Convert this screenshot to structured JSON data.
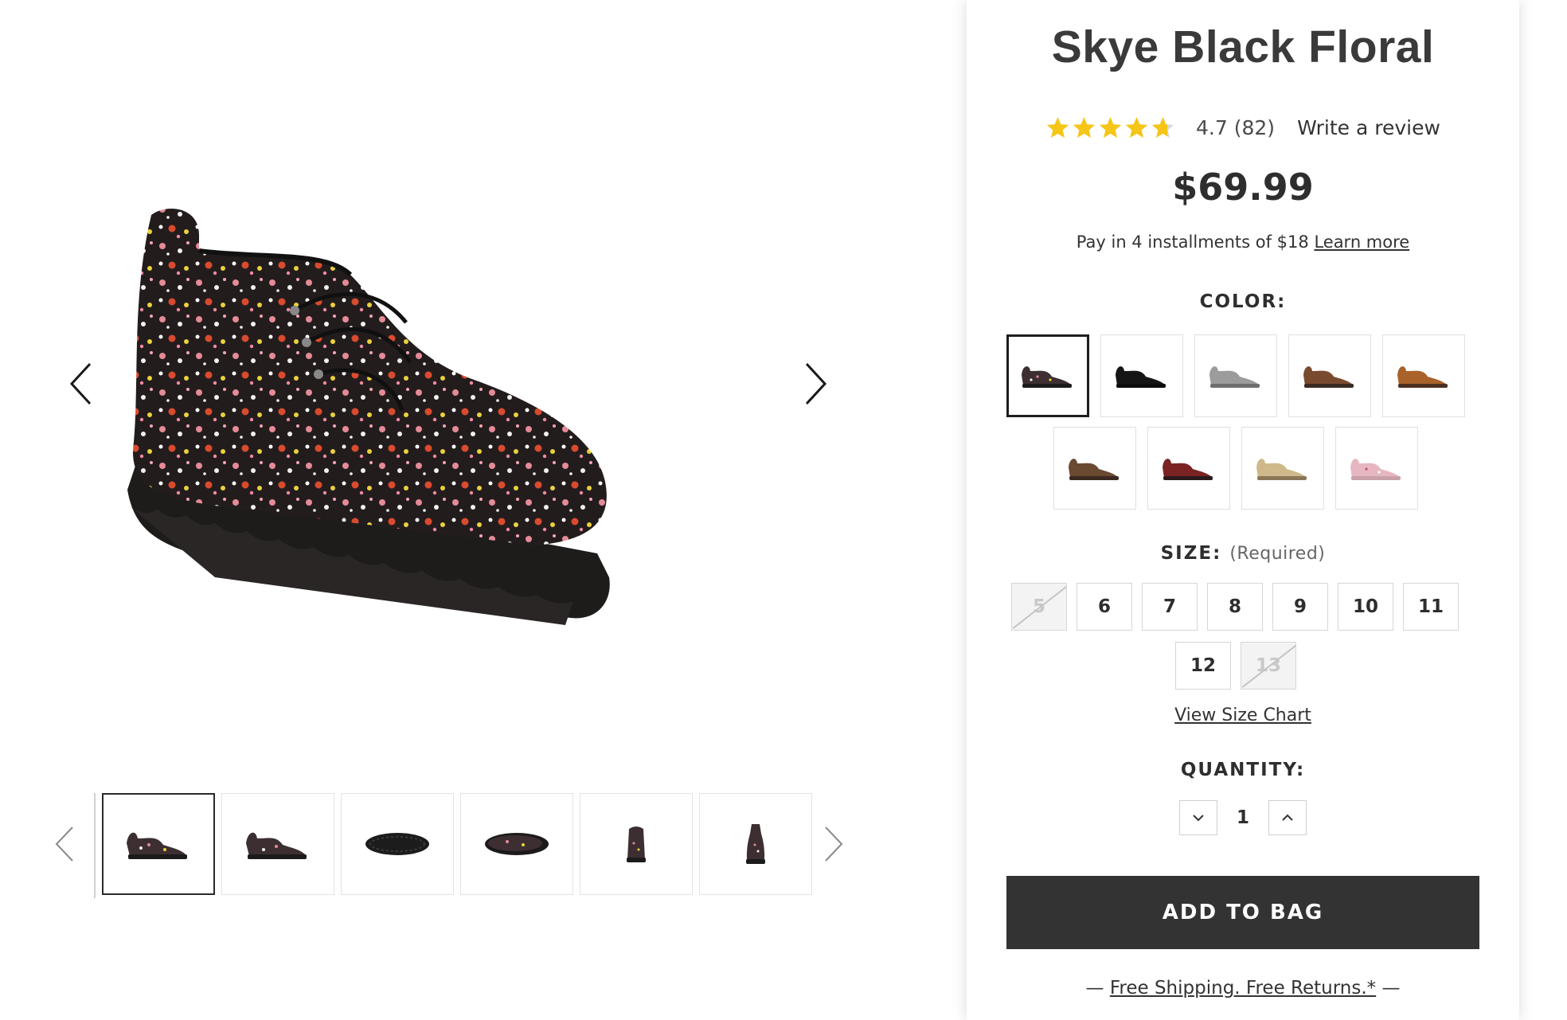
{
  "product": {
    "title": "Skye Black Floral",
    "rating_value": 4.7,
    "rating_text": "4.7 (82)",
    "write_review_label": "Write a review",
    "price": "$69.99",
    "installments_text": "Pay in 4 installments of $18",
    "learn_more_label": "Learn more"
  },
  "color": {
    "label": "COLOR:",
    "swatches": [
      {
        "name": "Black Floral",
        "color": "#3b3033",
        "selected": true
      },
      {
        "name": "Black",
        "color": "#151515"
      },
      {
        "name": "Gray",
        "color": "#9c9c9c"
      },
      {
        "name": "Chestnut",
        "color": "#7a4a2f"
      },
      {
        "name": "Hickory",
        "color": "#a9622a"
      },
      {
        "name": "Cocoa",
        "color": "#6b4a32"
      },
      {
        "name": "Red",
        "color": "#7b2323"
      },
      {
        "name": "Tan",
        "color": "#cfb98a"
      },
      {
        "name": "Pink Floral",
        "color": "#e6b7c1"
      }
    ]
  },
  "size": {
    "label": "SIZE:",
    "required_text": "(Required)",
    "options": [
      {
        "label": "5",
        "available": false
      },
      {
        "label": "6",
        "available": true
      },
      {
        "label": "7",
        "available": true
      },
      {
        "label": "8",
        "available": true
      },
      {
        "label": "9",
        "available": true
      },
      {
        "label": "10",
        "available": true
      },
      {
        "label": "11",
        "available": true
      },
      {
        "label": "12",
        "available": true
      },
      {
        "label": "13",
        "available": false
      }
    ],
    "size_chart_label": "View Size Chart"
  },
  "quantity": {
    "label": "QUANTITY:",
    "value": "1"
  },
  "cta": {
    "add_to_bag_label": "ADD TO BAG"
  },
  "shipping": {
    "dash_left": "—",
    "link_text": "Free Shipping. Free Returns.*",
    "dash_right": "—"
  },
  "gallery": {
    "thumbnail_views": [
      "side",
      "side",
      "sole",
      "top",
      "front",
      "back"
    ],
    "active_index": 0
  },
  "colors": {
    "star": "#f5c518",
    "button_bg": "#333333"
  }
}
